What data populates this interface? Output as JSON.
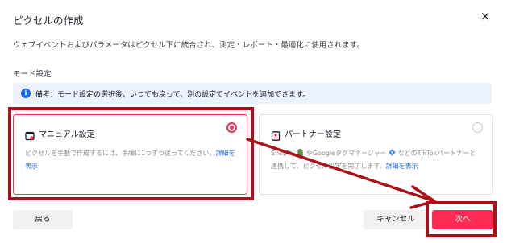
{
  "dialog": {
    "title": "ピクセルの作成",
    "close_label": "×",
    "description": "ウェブイベントおよびパラメータはピクセル下に統合され、測定・レポート・最適化に使用されます。",
    "mode_label": "モード設定",
    "note": {
      "icon": "info-icon",
      "icon_glyph": "i",
      "text": "備考：モード設定の選択後、いつでも戻って、別の設定でイベントを追加できます。"
    }
  },
  "cards": {
    "manual": {
      "icon": "manual-setup-icon",
      "title": "マニュアル設定",
      "body": "ピクセルを手動で作成するには、手順に1つずつ従ってください。",
      "link": "詳細を表示",
      "selected": true
    },
    "partner": {
      "icon": "partner-setup-icon",
      "title": "パートナー設定",
      "body_1": "Shopify",
      "body_2": "やGoogleタグマネージャー",
      "body_3": "などのTikTokパートナーと連携して、ピクセル設定を完了します。",
      "link": "詳細を表示",
      "selected": false
    }
  },
  "footer": {
    "back_label": "戻る",
    "cancel_label": "キャンセル",
    "next_label": "次へ"
  },
  "colors": {
    "accent": "#fe2c55",
    "link": "#1a66e8",
    "highlight": "#a8101a",
    "note_bg": "#ebf2fd"
  }
}
